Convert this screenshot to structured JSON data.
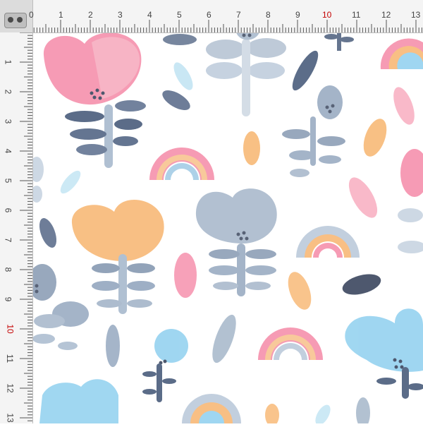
{
  "ruler": {
    "top_labels": [
      "0",
      "1",
      "2",
      "3",
      "4",
      "5",
      "6",
      "7",
      "8",
      "9",
      "10",
      "11",
      "12",
      "13"
    ],
    "left_labels": [
      "1",
      "2",
      "3",
      "4",
      "5",
      "6",
      "7",
      "8",
      "9",
      "10",
      "11",
      "12",
      "13"
    ],
    "highlight_label": "10",
    "unit": "cm"
  },
  "colors": {
    "pink": "#f28da8",
    "peach": "#f7b56f",
    "navy": "#3f5374",
    "slate": "#7f93ad",
    "light_blue": "#8fd0ef",
    "mist": "#b8c7d9"
  },
  "motifs": [
    "watercolor-flower",
    "watercolor-rainbow",
    "watercolor-leaf",
    "watercolor-petal"
  ]
}
